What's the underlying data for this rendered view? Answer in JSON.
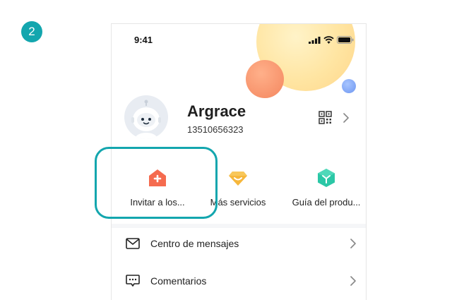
{
  "step_badge": "2",
  "status_bar": {
    "time": "9:41"
  },
  "profile": {
    "name": "Argrace",
    "phone": "13510656323"
  },
  "shortcuts": [
    {
      "label": "Invitar a los...",
      "icon": "home-plus-icon",
      "color": "#f56b4f"
    },
    {
      "label": "Más servicios",
      "icon": "diamond-icon",
      "color": "#f6b73c"
    },
    {
      "label": "Guía del produ...",
      "icon": "cube-icon",
      "color": "#2bc7a6"
    }
  ],
  "menu": [
    {
      "label": "Centro de mensajes",
      "icon": "mail-icon"
    },
    {
      "label": "Comentarios",
      "icon": "chat-icon"
    }
  ],
  "colors": {
    "accent": "#13a6ae"
  }
}
